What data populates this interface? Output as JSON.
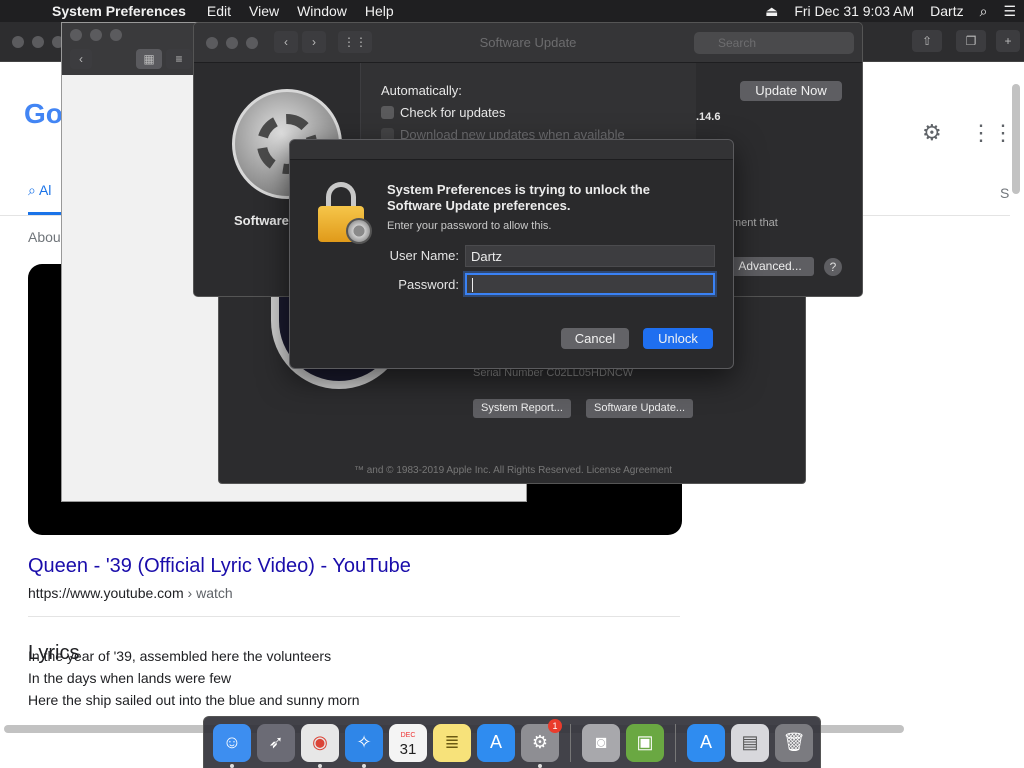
{
  "menubar": {
    "app_name": "System Preferences",
    "menus": [
      "Edit",
      "View",
      "Window",
      "Help"
    ],
    "datetime": "Fri Dec 31  9:03 AM",
    "user": "Dartz",
    "icons": [
      "apple-icon",
      "eject-icon",
      "search-icon",
      "list-icon"
    ]
  },
  "browser": {
    "logo_partial": "Go",
    "tab_all_partial": "Al",
    "about_partial": "Abou",
    "s_partial": "S",
    "result": {
      "title": "Queen - '39 (Official Lyric Video) - YouTube",
      "url": "https://www.youtube.com",
      "url_path": "› watch"
    },
    "lyrics": {
      "heading": "Lyrics",
      "lines": [
        "In the year of '39, assembled here the volunteers",
        "In the days when lands were few",
        "Here the ship sailed out into the blue and sunny morn"
      ]
    }
  },
  "software_update": {
    "title": "Software Update",
    "search_placeholder": "Search",
    "sidebar_label": "Software",
    "auto_label": "Automatically:",
    "check_updates": "Check for updates",
    "download_updates": "Download new updates when available",
    "version_partial": ".14.6",
    "ment_partial": "ment that",
    "update_now": "Update Now",
    "advanced": "Advanced...",
    "help": "?"
  },
  "about_mac": {
    "serial_label": "Serial Number",
    "serial_value": "C02LL05HDNCW",
    "system_report": "System Report...",
    "software_update_btn": "Software Update...",
    "copyright": "™ and © 1983-2019 Apple Inc. All Rights Reserved. License Agreement"
  },
  "auth_dialog": {
    "title": "System Preferences is trying to unlock the Software Update preferences.",
    "subtitle": "Enter your password to allow this.",
    "username_label": "User Name:",
    "username_value": "Dartz",
    "password_label": "Password:",
    "password_value": "",
    "cancel": "Cancel",
    "unlock": "Unlock"
  },
  "dock": {
    "items": [
      {
        "name": "finder-icon",
        "color": "#3d8ef0"
      },
      {
        "name": "launchpad-icon",
        "color": "#6b6b75"
      },
      {
        "name": "chrome-icon",
        "color": "#e7e7e7"
      },
      {
        "name": "safari-icon",
        "color": "#2f86e8"
      },
      {
        "name": "calendar-icon",
        "color": "#f4f4f4",
        "label": "31",
        "sub": "DEC"
      },
      {
        "name": "notes-icon",
        "color": "#f7e27a"
      },
      {
        "name": "app-store-icon",
        "color": "#2f8cf0"
      },
      {
        "name": "system-preferences-icon",
        "color": "#8e8e93",
        "badge": "1"
      },
      {
        "name": "image-capture-icon",
        "color": "#a8a8ac"
      },
      {
        "name": "minecraft-icon",
        "color": "#6aa842"
      },
      {
        "name": "app-store-downloads-icon",
        "color": "#2f8cf0"
      },
      {
        "name": "documents-icon",
        "color": "#d8d8dc"
      },
      {
        "name": "trash-icon",
        "color": "#7b7b80"
      }
    ]
  }
}
